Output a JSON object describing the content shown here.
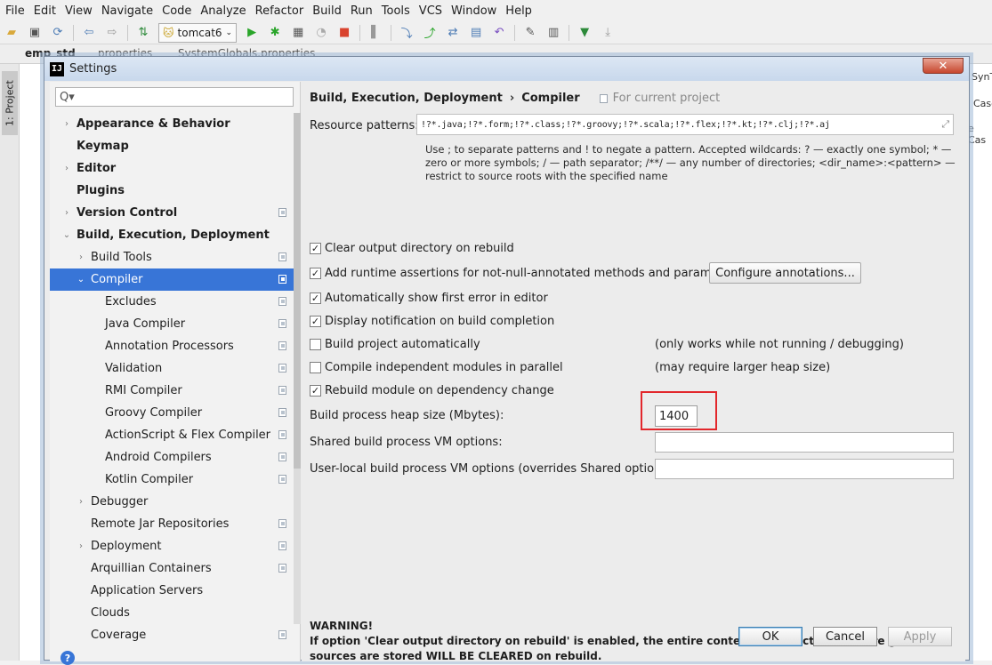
{
  "menu": [
    "File",
    "Edit",
    "View",
    "Navigate",
    "Code",
    "Analyze",
    "Refactor",
    "Build",
    "Run",
    "Tools",
    "VCS",
    "Window",
    "Help"
  ],
  "toolbar": {
    "run_config": "tomcat6"
  },
  "navbar": {
    "project": "emp_std",
    "tab1": "properties",
    "tab2": "SystemGlobals.properties"
  },
  "leftstrip": {
    "project_tab": "1: Project"
  },
  "right_fragments": {
    "a": "SynT",
    "b": "Case",
    "c": "e Cas"
  },
  "dialog": {
    "title": "Settings",
    "close": "✕",
    "search_placeholder": "Q▾",
    "tree": [
      {
        "label": "Appearance & Behavior",
        "arrow": "›",
        "bold": true,
        "level": 0
      },
      {
        "label": "Keymap",
        "arrow": "",
        "bold": true,
        "level": 0
      },
      {
        "label": "Editor",
        "arrow": "›",
        "bold": true,
        "level": 0
      },
      {
        "label": "Plugins",
        "arrow": "",
        "bold": true,
        "level": 0
      },
      {
        "label": "Version Control",
        "arrow": "›",
        "bold": true,
        "level": 0,
        "copy": true
      },
      {
        "label": "Build, Execution, Deployment",
        "arrow": "⌄",
        "bold": true,
        "level": 0
      },
      {
        "label": "Build Tools",
        "arrow": "›",
        "bold": false,
        "level": 1,
        "copy": true
      },
      {
        "label": "Compiler",
        "arrow": "⌄",
        "bold": false,
        "level": 1,
        "copy": true,
        "selected": true
      },
      {
        "label": "Excludes",
        "arrow": "",
        "bold": false,
        "level": 2,
        "copy": true
      },
      {
        "label": "Java Compiler",
        "arrow": "",
        "bold": false,
        "level": 2,
        "copy": true
      },
      {
        "label": "Annotation Processors",
        "arrow": "",
        "bold": false,
        "level": 2,
        "copy": true
      },
      {
        "label": "Validation",
        "arrow": "",
        "bold": false,
        "level": 2,
        "copy": true
      },
      {
        "label": "RMI Compiler",
        "arrow": "",
        "bold": false,
        "level": 2,
        "copy": true
      },
      {
        "label": "Groovy Compiler",
        "arrow": "",
        "bold": false,
        "level": 2,
        "copy": true
      },
      {
        "label": "ActionScript & Flex Compiler",
        "arrow": "",
        "bold": false,
        "level": 2,
        "copy": true
      },
      {
        "label": "Android Compilers",
        "arrow": "",
        "bold": false,
        "level": 2,
        "copy": true
      },
      {
        "label": "Kotlin Compiler",
        "arrow": "",
        "bold": false,
        "level": 2,
        "copy": true
      },
      {
        "label": "Debugger",
        "arrow": "›",
        "bold": false,
        "level": 1
      },
      {
        "label": "Remote Jar Repositories",
        "arrow": "",
        "bold": false,
        "level": 1,
        "copy": true
      },
      {
        "label": "Deployment",
        "arrow": "›",
        "bold": false,
        "level": 1,
        "copy": true
      },
      {
        "label": "Arquillian Containers",
        "arrow": "",
        "bold": false,
        "level": 1,
        "copy": true
      },
      {
        "label": "Application Servers",
        "arrow": "",
        "bold": false,
        "level": 1
      },
      {
        "label": "Clouds",
        "arrow": "",
        "bold": false,
        "level": 1
      },
      {
        "label": "Coverage",
        "arrow": "",
        "bold": false,
        "level": 1,
        "copy": true
      }
    ],
    "breadcrumb": {
      "parent": "Build, Execution, Deployment",
      "sep": "›",
      "current": "Compiler",
      "scope": "For current project"
    },
    "resource_patterns": {
      "label": "Resource patterns:",
      "value": "!?*.java;!?*.form;!?*.class;!?*.groovy;!?*.scala;!?*.flex;!?*.kt;!?*.clj;!?*.aj",
      "hint": "Use ; to separate patterns and ! to negate a pattern. Accepted wildcards: ? — exactly one symbol; * — zero or more symbols; / — path separator; /**/ — any number of directories; <dir_name>:<pattern> — restrict to source roots with the specified name"
    },
    "options": [
      {
        "label": "Clear output directory on rebuild",
        "checked": true
      },
      {
        "label": "Add runtime assertions for not-null-annotated methods and parameters",
        "checked": true
      },
      {
        "label": "Automatically show first error in editor",
        "checked": true
      },
      {
        "label": "Display notification on build completion",
        "checked": true
      },
      {
        "label": "Build project automatically",
        "checked": false,
        "note": "(only works while not running / debugging)"
      },
      {
        "label": "Compile independent modules in parallel",
        "checked": false,
        "note": "(may require larger heap size)"
      },
      {
        "label": "Rebuild module on dependency change",
        "checked": true
      }
    ],
    "configure_annotations": "Configure annotations...",
    "heap": {
      "label": "Build process heap size (Mbytes):",
      "value": "1400"
    },
    "shared_vm": {
      "label": "Shared build process VM options:",
      "value": ""
    },
    "user_vm": {
      "label": "User-local build process VM options (overrides Shared options):",
      "value": ""
    },
    "warning": {
      "title": "WARNING!",
      "text": "If option 'Clear output directory on rebuild' is enabled, the entire contents of directories where generated sources are stored WILL BE CLEARED on rebuild."
    },
    "buttons": {
      "ok": "OK",
      "cancel": "Cancel",
      "apply": "Apply",
      "help": "?"
    }
  }
}
